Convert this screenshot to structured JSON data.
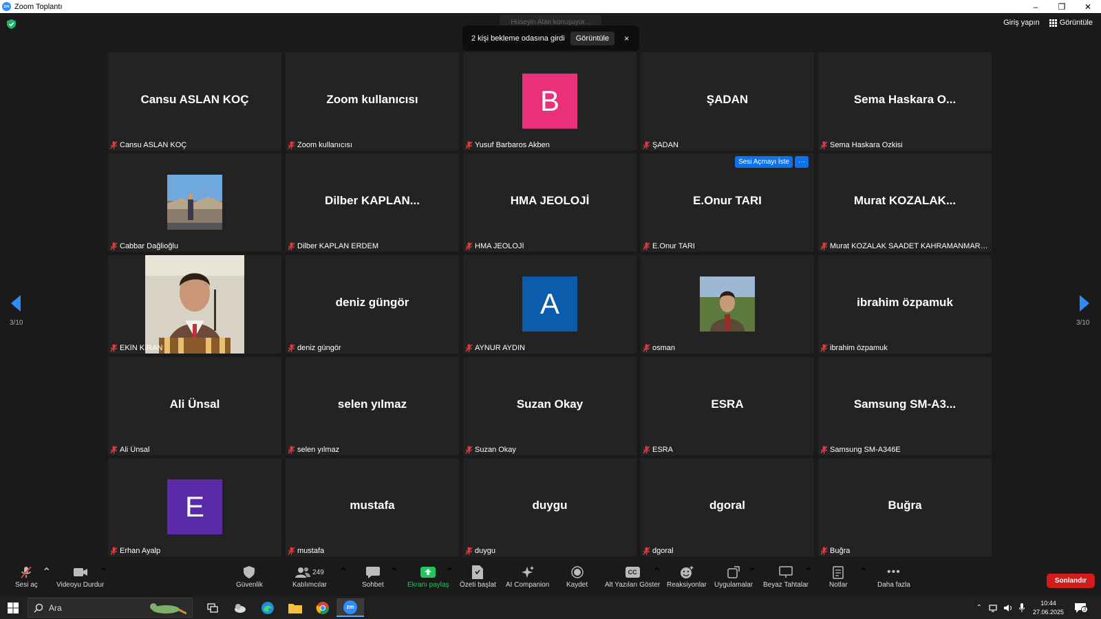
{
  "window": {
    "title": "Zoom Toplantı",
    "app_icon_text": "zm"
  },
  "top_bar": {
    "speaker_hint": "Hüseyin Alan konuşuyor...",
    "waiting_message": "2 kişi bekleme odasına girdi",
    "waiting_view_label": "Görüntüle",
    "waiting_close": "×",
    "signin_label": "Giriş yapın",
    "view_label": "Görüntüle"
  },
  "pagination": {
    "left": "3/10",
    "right": "3/10"
  },
  "tiles": [
    {
      "big": "Cansu ASLAN KOÇ",
      "label": "Cansu ASLAN KOÇ"
    },
    {
      "big": "Zoom kullanıcısı",
      "label": "Zoom kullanıcısı"
    },
    {
      "avatar_letter": "B",
      "avatar_color": "#e8317a",
      "label": "Yusuf Barbaros Akben"
    },
    {
      "big": "ŞADAN",
      "label": "ŞADAN"
    },
    {
      "big": "Sema Haskara O...",
      "label": "Sema Haskara Ozkisi"
    },
    {
      "photo": "landscape",
      "label": "Cabbar Dağlioğlu"
    },
    {
      "big": "Dilber  KAPLAN...",
      "label": "Dilber KAPLAN ERDEM"
    },
    {
      "big": "HMA JEOLOJİ",
      "label": "HMA JEOLOJİ"
    },
    {
      "big": "E.Onur TARI",
      "label": "E.Onur TARI",
      "actions": {
        "unmute": "Sesi Açmayı İste",
        "more": "···"
      }
    },
    {
      "big": "Murat  KOZALAK...",
      "label": "Murat KOZALAK SAADET KAHRAMANMARAŞ ..."
    },
    {
      "photo": "speaker",
      "label": "EKİN KIRAN"
    },
    {
      "big": "deniz güngör",
      "label": "deniz güngör"
    },
    {
      "avatar_letter": "A",
      "avatar_color": "#0b5cab",
      "label": "AYNUR AYDIN"
    },
    {
      "photo": "portrait",
      "label": "osman"
    },
    {
      "big": "ibrahim özpamuk",
      "label": "ibrahim özpamuk"
    },
    {
      "big": "Ali Ünsal",
      "label": "Ali Ünsal"
    },
    {
      "big": "selen yılmaz",
      "label": "selen yılmaz"
    },
    {
      "big": "Suzan Okay",
      "label": "Suzan Okay"
    },
    {
      "big": "ESRA",
      "label": "ESRA"
    },
    {
      "big": "Samsung  SM-A3...",
      "label": "Samsung SM-A346E"
    },
    {
      "avatar_letter": "E",
      "avatar_color": "#5b2aa8",
      "label": "Erhan Ayalp"
    },
    {
      "big": "mustafa",
      "label": "mustafa"
    },
    {
      "big": "duygu",
      "label": "duygu"
    },
    {
      "big": "dgoral",
      "label": "dgoral"
    },
    {
      "big": "Buğra",
      "label": "Buğra"
    }
  ],
  "toolbar": {
    "unmute": "Sesi aç",
    "video": "Videoyu Durdur",
    "security": "Güvenlik",
    "participants": "Katılımcılar",
    "participants_count": "249",
    "chat": "Sohbet",
    "share": "Ekranı paylaş",
    "summary": "Özeti başlat",
    "ai": "AI Companion",
    "record": "Kaydet",
    "captions": "Alt Yazıları Göster",
    "reactions": "Reaksiyonlar",
    "apps": "Uygulamalar",
    "whiteboards": "Beyaz Tahtalar",
    "notes": "Notlar",
    "more": "Daha fazla",
    "end": "Sonlandır",
    "cc": "CC"
  },
  "taskbar": {
    "search": "Ara",
    "time": "10:44",
    "date": "27.06.2025",
    "notif_count": "3"
  },
  "colors": {
    "accent": "#0e72ed",
    "share_green": "#22c55e",
    "end_red": "#d21b1b",
    "mic_red": "#e0393e"
  }
}
